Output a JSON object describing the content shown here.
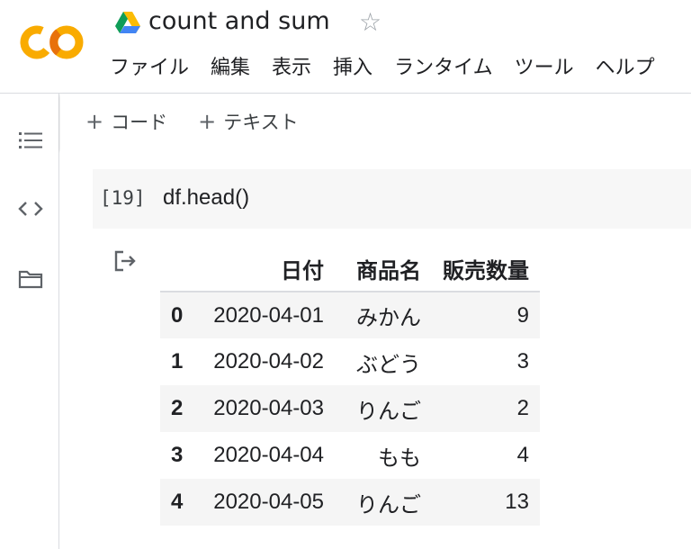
{
  "app": {
    "title": "count and sum",
    "menu": [
      "ファイル",
      "編集",
      "表示",
      "挿入",
      "ランタイム",
      "ツール",
      "ヘルプ"
    ]
  },
  "toolbar": {
    "add_code_label": "コード",
    "add_text_label": "テキスト"
  },
  "sidebar": {
    "items": [
      "table-of-contents-icon",
      "code-snippets-icon",
      "files-icon"
    ]
  },
  "cell": {
    "execution_count": "[19]",
    "code": "df.head()"
  },
  "dataframe": {
    "columns": [
      "日付",
      "商品名",
      "販売数量"
    ],
    "rows": [
      {
        "index": "0",
        "date": "2020-04-01",
        "product": "みかん",
        "qty": "9"
      },
      {
        "index": "1",
        "date": "2020-04-02",
        "product": "ぶどう",
        "qty": "3"
      },
      {
        "index": "2",
        "date": "2020-04-03",
        "product": "りんご",
        "qty": "2"
      },
      {
        "index": "3",
        "date": "2020-04-04",
        "product": "もも",
        "qty": "4"
      },
      {
        "index": "4",
        "date": "2020-04-05",
        "product": "りんご",
        "qty": "13"
      }
    ]
  },
  "colors": {
    "logo_orange": "#f9ab00",
    "logo_yellow": "#e8710a",
    "border": "#dadce0",
    "cell_bg": "#f7f7f7",
    "row_alt_bg": "#f5f5f5"
  }
}
